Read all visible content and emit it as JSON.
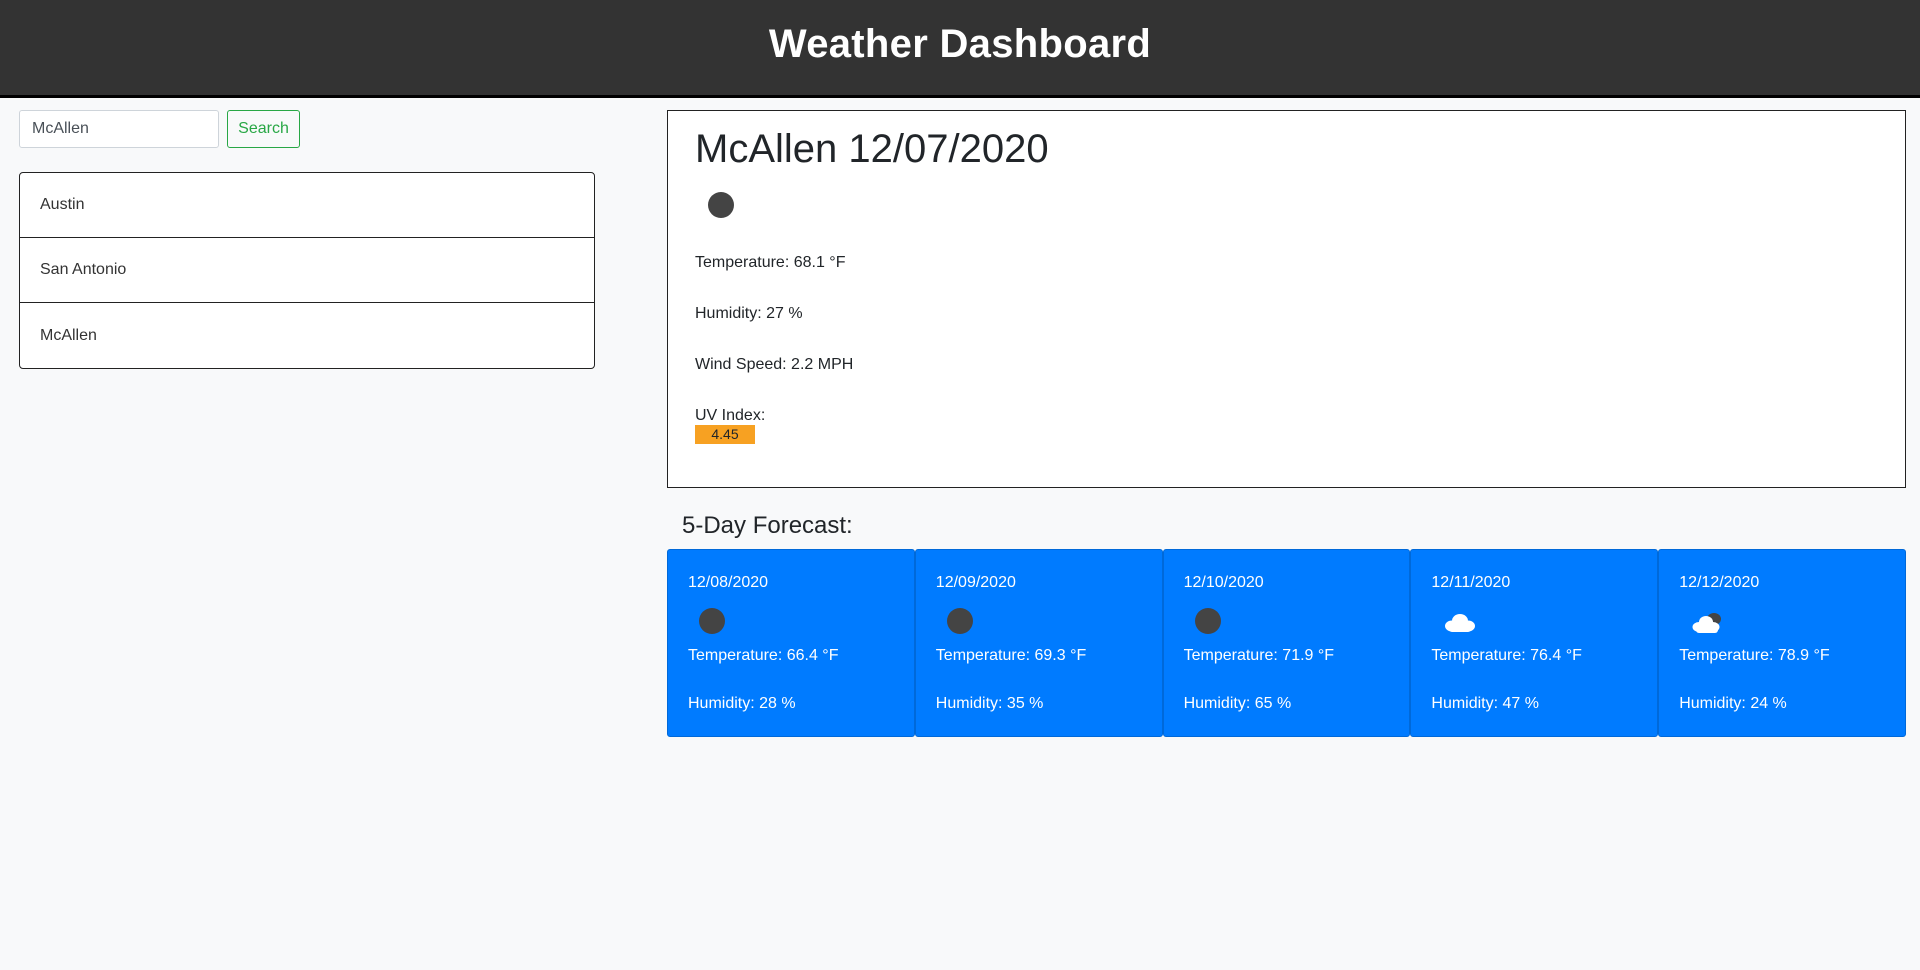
{
  "header": {
    "title": "Weather Dashboard"
  },
  "search": {
    "value": "McAllen",
    "button_label": "Search"
  },
  "history": [
    {
      "label": "Austin"
    },
    {
      "label": "San Antonio"
    },
    {
      "label": "McAllen"
    }
  ],
  "current": {
    "title": "McAllen 12/07/2020",
    "icon": "clear-sky-icon",
    "temperature": "Temperature: 68.1 °F",
    "humidity": "Humidity: 27 %",
    "wind": "Wind Speed: 2.2 MPH",
    "uv_label": "UV Index:",
    "uv_value": "4.45",
    "uv_color": "#f7a122"
  },
  "forecast": {
    "title": "5-Day Forecast:",
    "days": [
      {
        "date": "12/08/2020",
        "icon": "clear-sky-icon",
        "temperature": "Temperature: 66.4 °F",
        "humidity": "Humidity: 28 %"
      },
      {
        "date": "12/09/2020",
        "icon": "clear-sky-icon",
        "temperature": "Temperature: 69.3 °F",
        "humidity": "Humidity: 35 %"
      },
      {
        "date": "12/10/2020",
        "icon": "clear-sky-icon",
        "temperature": "Temperature: 71.9 °F",
        "humidity": "Humidity: 65 %"
      },
      {
        "date": "12/11/2020",
        "icon": "cloud-icon",
        "temperature": "Temperature: 76.4 °F",
        "humidity": "Humidity: 47 %"
      },
      {
        "date": "12/12/2020",
        "icon": "broken-clouds-icon",
        "temperature": "Temperature: 78.9 °F",
        "humidity": "Humidity: 24 %"
      }
    ]
  },
  "colors": {
    "header_bg": "#333333",
    "card_blue": "#007bff",
    "search_green": "#28a745"
  }
}
